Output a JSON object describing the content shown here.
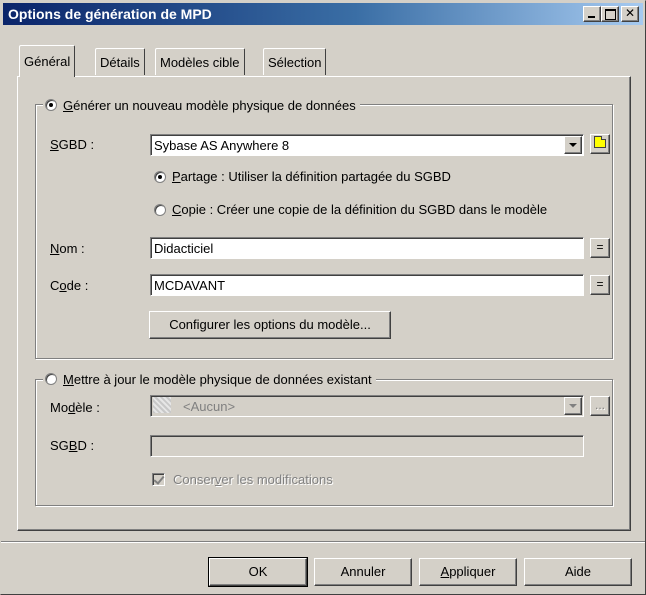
{
  "window": {
    "title": "Options de génération de MPD"
  },
  "tabs": [
    {
      "label": "Général"
    },
    {
      "label": "Détails"
    },
    {
      "label": "Modèles cible"
    },
    {
      "label": "Sélection"
    }
  ],
  "generate_group": {
    "radio_prefix": "",
    "radio_label_u": "G",
    "radio_label_rest": "énérer un nouveau modèle physique de données",
    "sgbd_label_u": "S",
    "sgbd_label_rest": "GBD :",
    "sgbd_value": "Sybase AS Anywhere 8",
    "partage_u": "P",
    "partage_rest": "artage : Utiliser la définition partagée du SGBD",
    "copie_u": "C",
    "copie_rest": "opie : Créer une copie de la définition du SGBD dans le modèle",
    "nom_label_u": "N",
    "nom_label_rest": "om :",
    "nom_value": "Didacticiel",
    "code_label_pre": "C",
    "code_label_u": "o",
    "code_label_rest": "de :",
    "code_value": "MCDAVANT",
    "equals_label": "=",
    "configure_button": "Configurer les options du modèle..."
  },
  "update_group": {
    "radio_label_u": "M",
    "radio_label_rest": "ettre à jour le modèle physique de données existant",
    "modele_label_pre": "Mo",
    "modele_label_u": "d",
    "modele_label_rest": "èle :",
    "modele_value": "<Aucun>",
    "browse_label": "...",
    "sgbd_label_pre": "SG",
    "sgbd_label_u": "B",
    "sgbd_label_rest": "D :",
    "sgbd_value": "",
    "keep_pre": "Conser",
    "keep_u": "v",
    "keep_rest": "er les modifications"
  },
  "buttons": {
    "ok": "OK",
    "cancel": "Annuler",
    "apply_u": "A",
    "apply_rest": "ppliquer",
    "help": "Aide"
  }
}
